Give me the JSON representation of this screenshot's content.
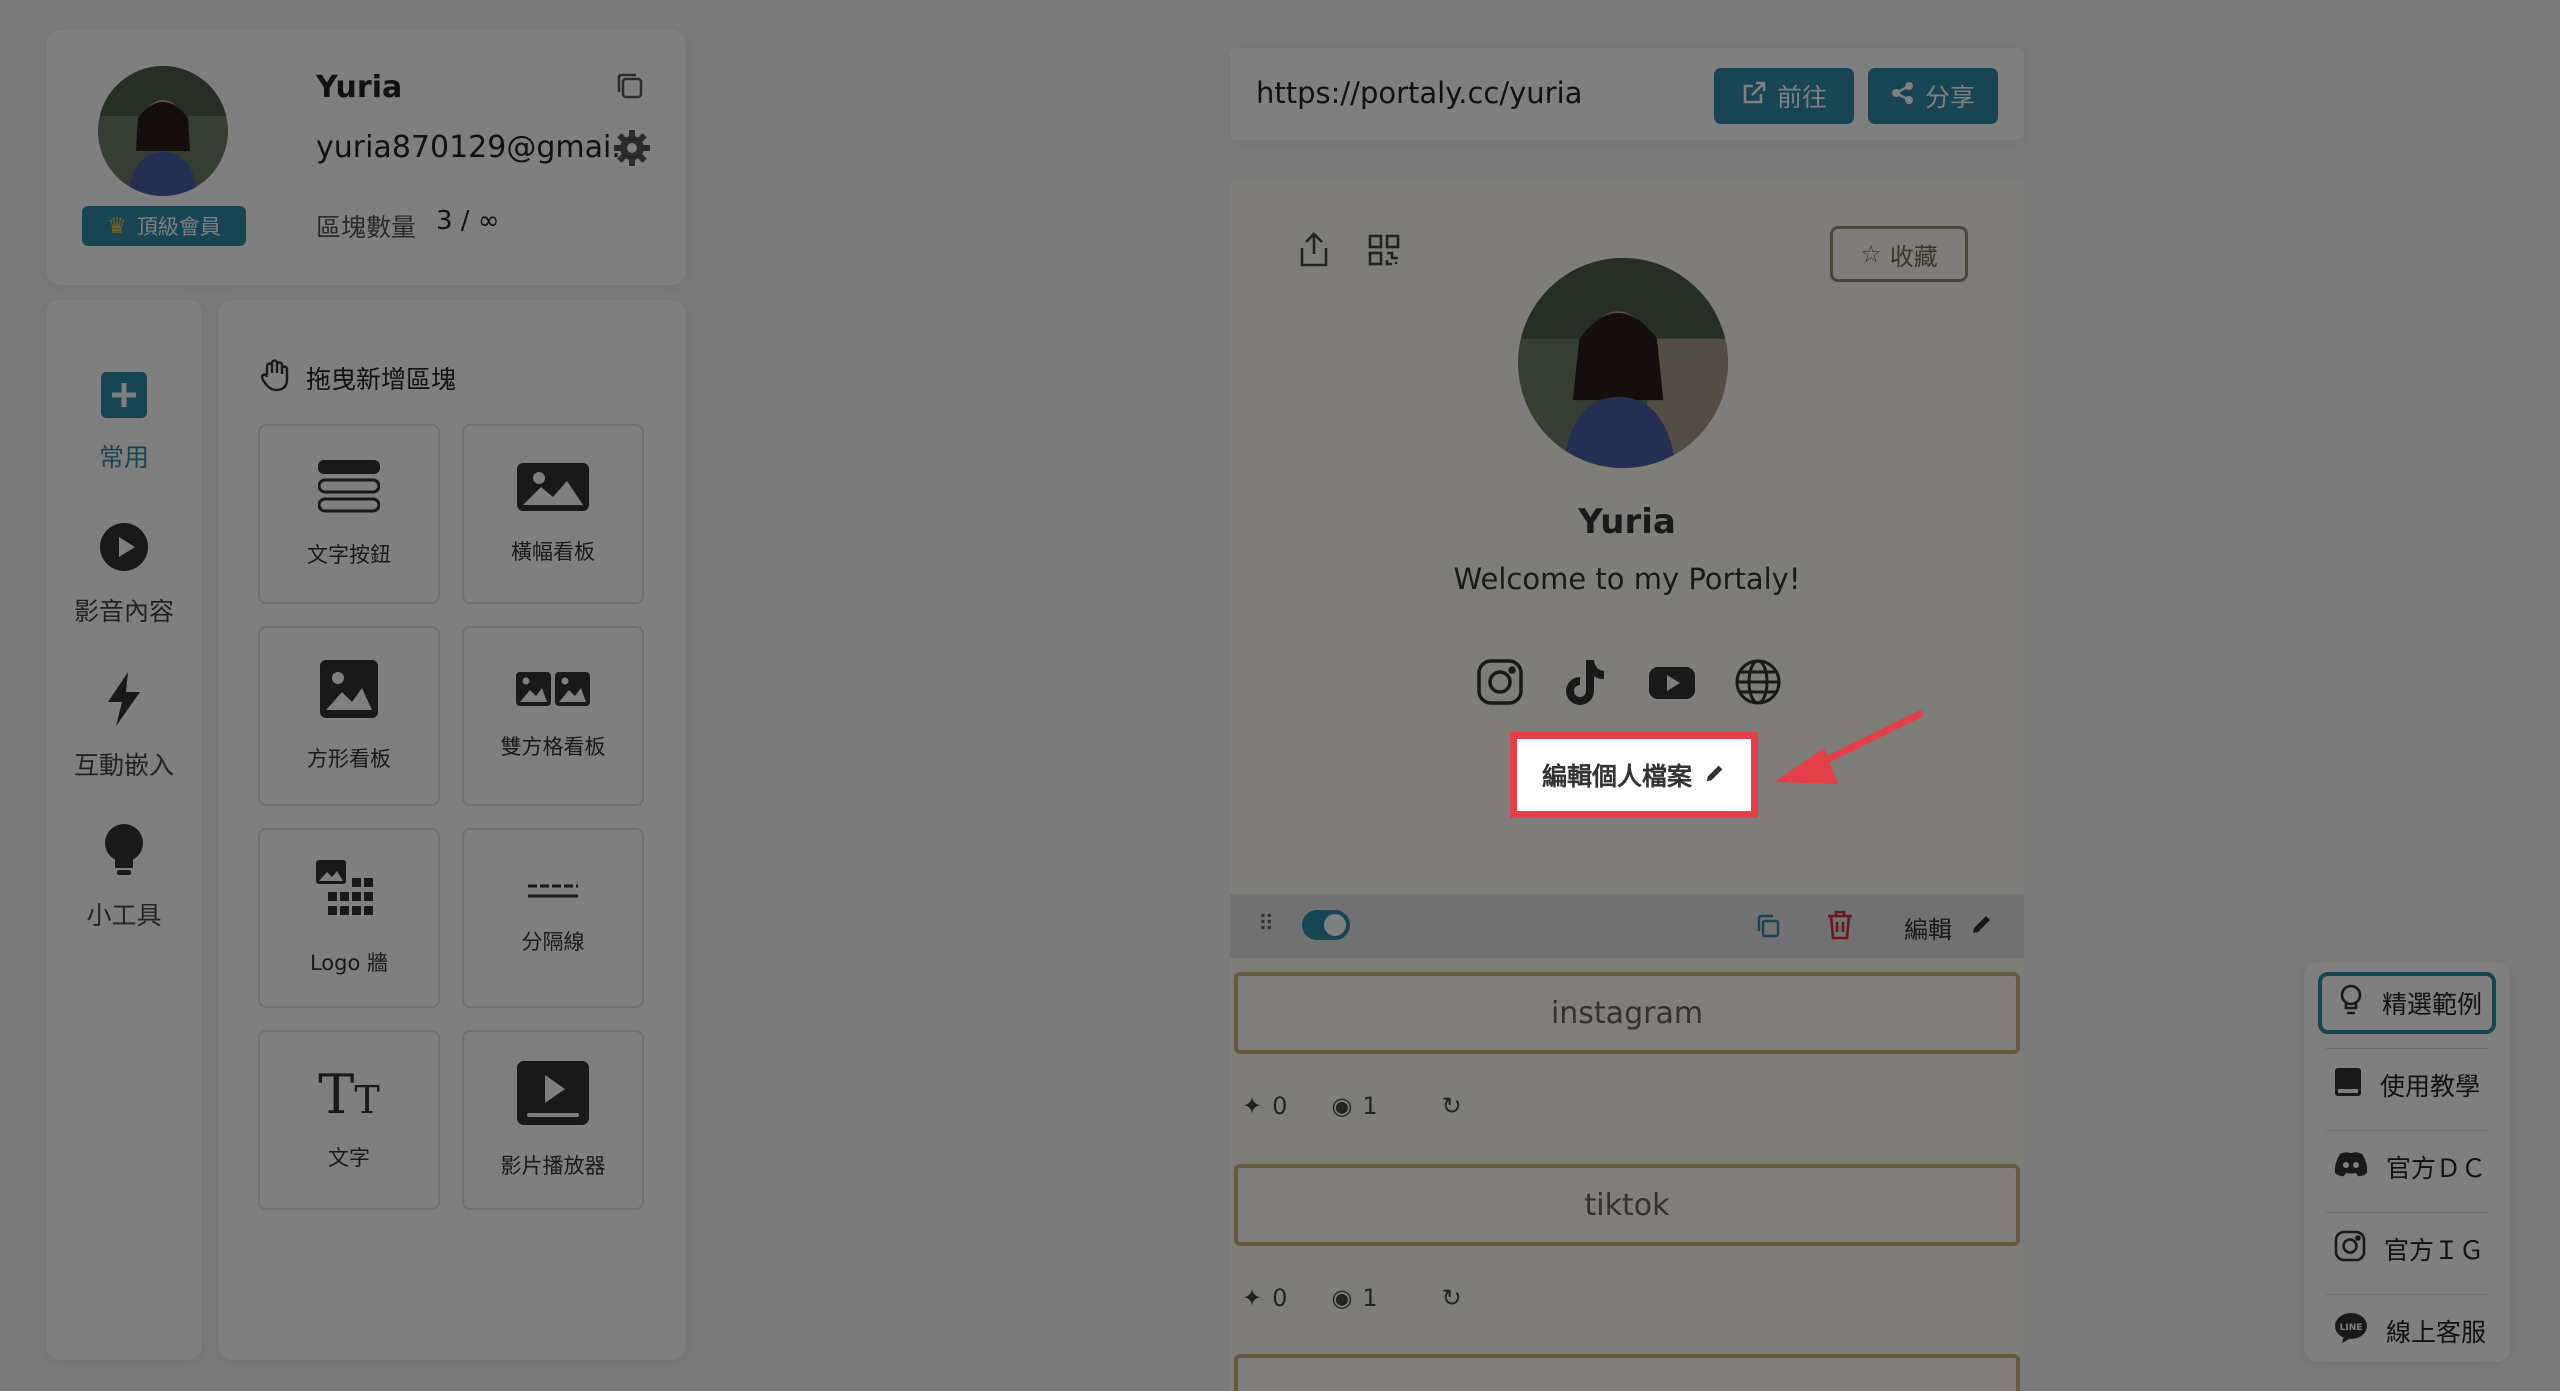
{
  "profile": {
    "name": "Yuria",
    "email": "yuria870129@gmai...",
    "badge": "頂級會員",
    "blocks_label": "區塊數量",
    "blocks_value": "3 / ∞"
  },
  "rail": {
    "items": [
      {
        "label": "常用",
        "icon": "plus-square-icon",
        "active": true
      },
      {
        "label": "影音內容",
        "icon": "play-circle-icon",
        "active": false
      },
      {
        "label": "互動嵌入",
        "icon": "lightning-icon",
        "active": false
      },
      {
        "label": "小工具",
        "icon": "bulb-icon",
        "active": false
      }
    ]
  },
  "palette": {
    "title": "拖曳新增區塊",
    "tiles": [
      {
        "label": "文字按鈕",
        "icon": "text-button-icon"
      },
      {
        "label": "橫幅看板",
        "icon": "banner-icon"
      },
      {
        "label": "方形看板",
        "icon": "square-image-icon"
      },
      {
        "label": "雙方格看板",
        "icon": "double-image-icon"
      },
      {
        "label": "Logo 牆",
        "icon": "logo-wall-icon"
      },
      {
        "label": "分隔線",
        "icon": "divider-icon"
      },
      {
        "label": "文字",
        "icon": "text-icon"
      },
      {
        "label": "影片播放器",
        "icon": "video-player-icon"
      }
    ]
  },
  "urlbar": {
    "url": "https://portaly.cc/yuria",
    "go_label": "前往",
    "share_label": "分享"
  },
  "preview": {
    "favorite_label": "收藏",
    "name": "Yuria",
    "bio": "Welcome to my Portaly!",
    "edit_profile_label": "編輯個人檔案",
    "socials": [
      "instagram-icon",
      "tiktok-icon",
      "youtube-icon",
      "globe-icon"
    ],
    "block_edit_label": "編輯",
    "links": [
      {
        "label": "instagram",
        "clicks": "0",
        "views": "1"
      },
      {
        "label": "tiktok",
        "clicks": "0",
        "views": "1"
      }
    ]
  },
  "help": {
    "items": [
      {
        "label": "精選範例",
        "icon": "bulb-icon",
        "active": true
      },
      {
        "label": "使用教學",
        "icon": "book-icon",
        "active": false
      },
      {
        "label": "官方ＤＣ",
        "icon": "discord-icon",
        "active": false
      },
      {
        "label": "官方ＩＧ",
        "icon": "instagram-icon",
        "active": false
      },
      {
        "label": "線上客服",
        "icon": "line-icon",
        "active": false
      }
    ]
  },
  "colors": {
    "accent": "#2e8ba6",
    "highlight": "#e53f49",
    "link_border": "#cdb67e"
  }
}
